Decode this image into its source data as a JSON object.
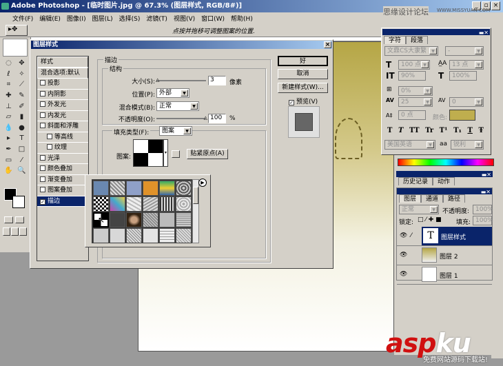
{
  "window": {
    "title": "Adobe Photoshop - [临时图片.jpg @ 67.3% (图层样式, RGB/8#)]",
    "controls": [
      "_",
      "▫",
      "×"
    ]
  },
  "watermark_top": {
    "cn": "思缘设计论坛",
    "url": "WWW.MISSYUAN.COM"
  },
  "menu": [
    "文件(F)",
    "编辑(E)",
    "图像(I)",
    "图层(L)",
    "选择(S)",
    "滤镜(T)",
    "视图(V)",
    "窗口(W)",
    "帮助(H)"
  ],
  "options": {
    "hint": "点按并拖移可调整图案的位置."
  },
  "dialog": {
    "title": "图层样式",
    "styles": [
      {
        "label": "样式",
        "type": "header"
      },
      {
        "label": "混合选项:默认",
        "type": "header"
      },
      {
        "label": "投影",
        "checked": false
      },
      {
        "label": "内阴影",
        "checked": false
      },
      {
        "label": "外发光",
        "checked": false
      },
      {
        "label": "内发光",
        "checked": false
      },
      {
        "label": "斜面和浮雕",
        "checked": false
      },
      {
        "label": "等高线",
        "checked": false,
        "sub": true
      },
      {
        "label": "纹理",
        "checked": false,
        "sub": true
      },
      {
        "label": "光泽",
        "checked": false
      },
      {
        "label": "颜色叠加",
        "checked": false
      },
      {
        "label": "渐变叠加",
        "checked": false
      },
      {
        "label": "图案叠加",
        "checked": false
      },
      {
        "label": "描边",
        "checked": true,
        "selected": true
      }
    ],
    "stroke": {
      "group": "描边",
      "structure": "结构",
      "size_label": "大小(S):",
      "size": "3",
      "size_unit": "像素",
      "size_fraction": 0.02,
      "position_label": "位置(P):",
      "position": "外部",
      "blend_label": "混合模式(B):",
      "blend": "正常",
      "opacity_label": "不透明度(O):",
      "opacity": "100",
      "opacity_unit": "%",
      "opacity_fraction": 1.0,
      "fill_label": "填充类型(F):",
      "fill": "图案",
      "pattern_label": "图案:",
      "snap_label": "贴紧原点(A)"
    },
    "buttons": {
      "ok": "好",
      "cancel": "取消",
      "new_style": "新建样式(W)...",
      "preview": "预览(V)",
      "preview_checked": true
    }
  },
  "character": {
    "tabs": [
      "字符",
      "段落"
    ],
    "font": "文鼎CS大隶繁",
    "style": "-",
    "size": "100 点",
    "leading": "13 点",
    "vscale": "90%",
    "hscale": "100%",
    "baseline_shift_pct": "0%",
    "tracking": "25",
    "kerning": "0",
    "baseline": "0 点",
    "color_label": "颜色:",
    "color": "#bfae4e",
    "styles": [
      "T",
      "T",
      "TT",
      "Tr",
      "T¹",
      "T₁",
      "T",
      "Ŧ"
    ],
    "language": "美国英语",
    "aa_label": "aa",
    "antialias": "锐利"
  },
  "history": {
    "tabs": [
      "历史记录",
      "动作"
    ]
  },
  "layers": {
    "tabs": [
      "图层",
      "通道",
      "路径"
    ],
    "mode": "正常",
    "opacity_label": "不透明度:",
    "opacity": "100%",
    "lock_label": "锁定:",
    "fill_label": "填充:",
    "fill": "100%",
    "items": [
      {
        "name": "图层样式",
        "thumb": "T",
        "selected": true
      },
      {
        "name": "图层 2",
        "selected": false
      },
      {
        "name": "图层 1",
        "selected": false
      }
    ]
  },
  "watermark": {
    "brand_a": "asp",
    "brand_b": "ku",
    ".com": ".com",
    "tagline": "免费网站源码下载站!"
  }
}
